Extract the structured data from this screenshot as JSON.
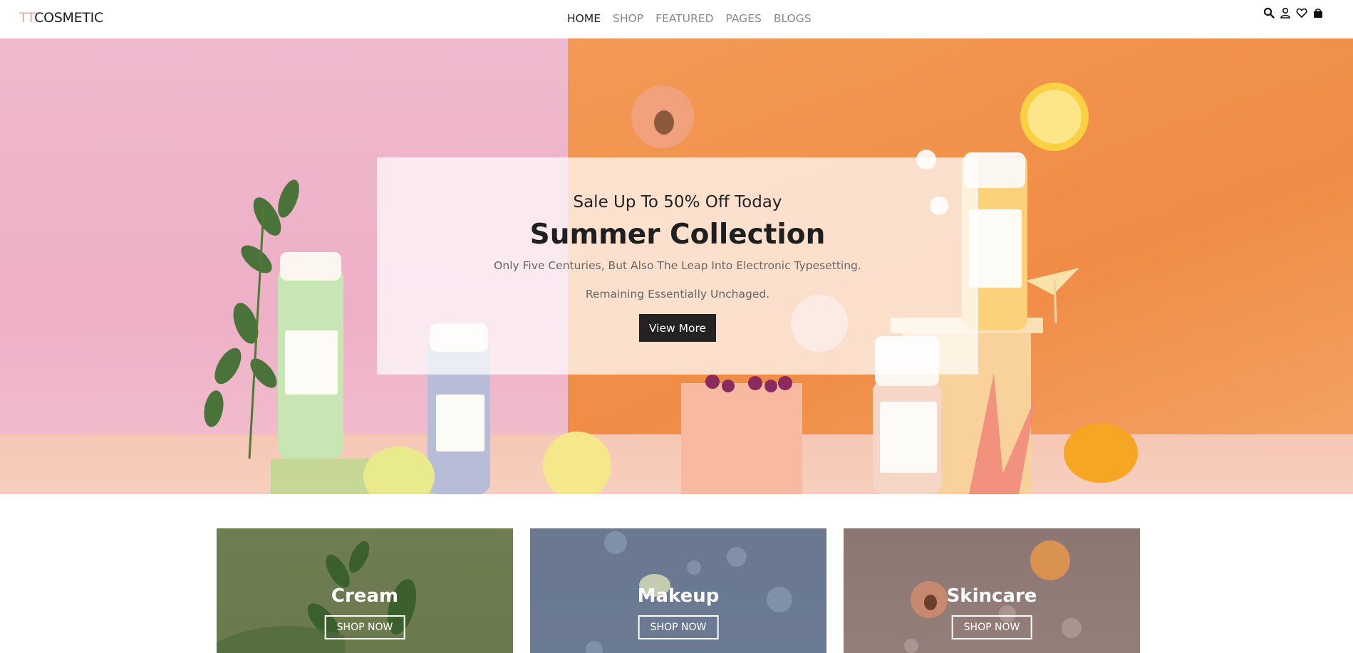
{
  "header": {
    "logo_prefix": "TT",
    "logo_main": "COSMETIC",
    "nav": [
      {
        "label": "HOME",
        "active": true
      },
      {
        "label": "SHOP",
        "active": false
      },
      {
        "label": "FEATURED",
        "active": false
      },
      {
        "label": "PAGES",
        "active": false
      },
      {
        "label": "BLOGS",
        "active": false
      }
    ],
    "icons": [
      "search-icon",
      "user-icon",
      "heart-icon",
      "bag-icon"
    ]
  },
  "hero": {
    "sale": "Sale Up To 50% Off Today",
    "title": "Summer Collection",
    "desc1": "Only Five Centuries, But Also The Leap Into Electronic Typesetting.",
    "desc2": "Remaining Essentially Unchaged.",
    "button": "View More",
    "colors": {
      "left": "#eeb0c7",
      "right": "#f08c45"
    }
  },
  "categories": [
    {
      "title": "Cream",
      "button": "SHOP NOW",
      "color": "#6f7e52"
    },
    {
      "title": "Makeup",
      "button": "SHOP NOW",
      "color": "#6a7890"
    },
    {
      "title": "Skincare",
      "button": "SHOP NOW",
      "color": "#8c7672"
    }
  ]
}
